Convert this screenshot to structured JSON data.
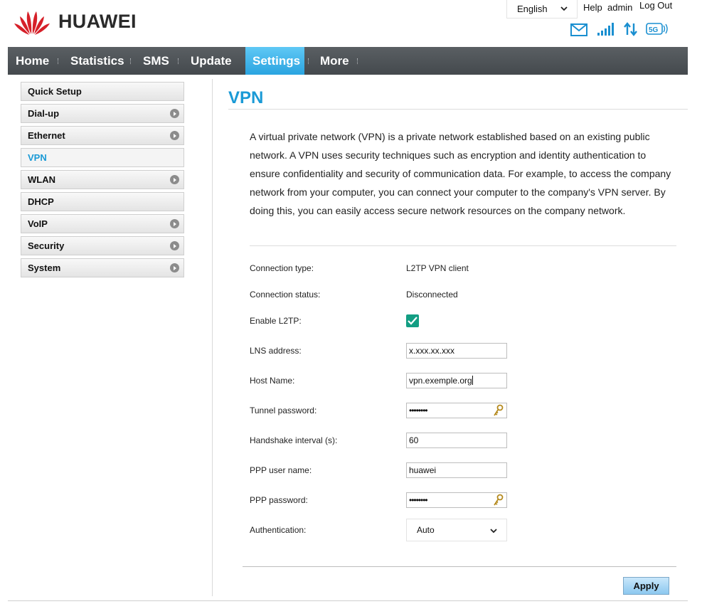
{
  "brand": {
    "name": "HUAWEI",
    "logo_color": "#d62029"
  },
  "header": {
    "language": "English",
    "help_label": "Help",
    "user_label": "admin",
    "logout_label": "Log Out",
    "status_icons": [
      "mail-icon",
      "signal-strength-icon",
      "data-transfer-icon",
      "5g-icon"
    ]
  },
  "nav": {
    "items": [
      "Home",
      "Statistics",
      "SMS",
      "Update",
      "Settings",
      "More"
    ],
    "active": "Settings",
    "active_color": "#2aa4e0"
  },
  "sidebar": {
    "items": [
      {
        "label": "Quick Setup",
        "has_arrow": false
      },
      {
        "label": "Dial-up",
        "has_arrow": true
      },
      {
        "label": "Ethernet",
        "has_arrow": true
      },
      {
        "label": "VPN",
        "has_arrow": false
      },
      {
        "label": "WLAN",
        "has_arrow": true
      },
      {
        "label": "DHCP",
        "has_arrow": false
      },
      {
        "label": "VoIP",
        "has_arrow": true
      },
      {
        "label": "Security",
        "has_arrow": true
      },
      {
        "label": "System",
        "has_arrow": true
      }
    ],
    "active": "VPN"
  },
  "page": {
    "title": "VPN",
    "description": "A virtual private network (VPN) is a private network established based on an existing public network. A VPN uses security techniques such as encryption and identity authentication to ensure confidentiality and security of communication data. For example, to access the company network from your computer, you can connect your computer to the company's VPN server. By doing this, you can easily access secure network resources on the company network."
  },
  "form": {
    "connection_type": {
      "label": "Connection type:",
      "value": "L2TP VPN client"
    },
    "connection_status": {
      "label": "Connection status:",
      "value": "Disconnected"
    },
    "enable_l2tp": {
      "label": "Enable L2TP:",
      "checked": true
    },
    "lns_address": {
      "label": "LNS address:",
      "value": "x.xxx.xx.xxx"
    },
    "host_name": {
      "label": "Host Name:",
      "value": "vpn.exemple.org"
    },
    "tunnel_password": {
      "label": "Tunnel password:",
      "value": "••••••••"
    },
    "handshake_interval": {
      "label": "Handshake interval (s):",
      "value": "60"
    },
    "ppp_user_name": {
      "label": "PPP user name:",
      "value": "huawei"
    },
    "ppp_password": {
      "label": "PPP password:",
      "value": "••••••••"
    },
    "authentication": {
      "label": "Authentication:",
      "value": "Auto"
    }
  },
  "actions": {
    "apply_label": "Apply"
  }
}
